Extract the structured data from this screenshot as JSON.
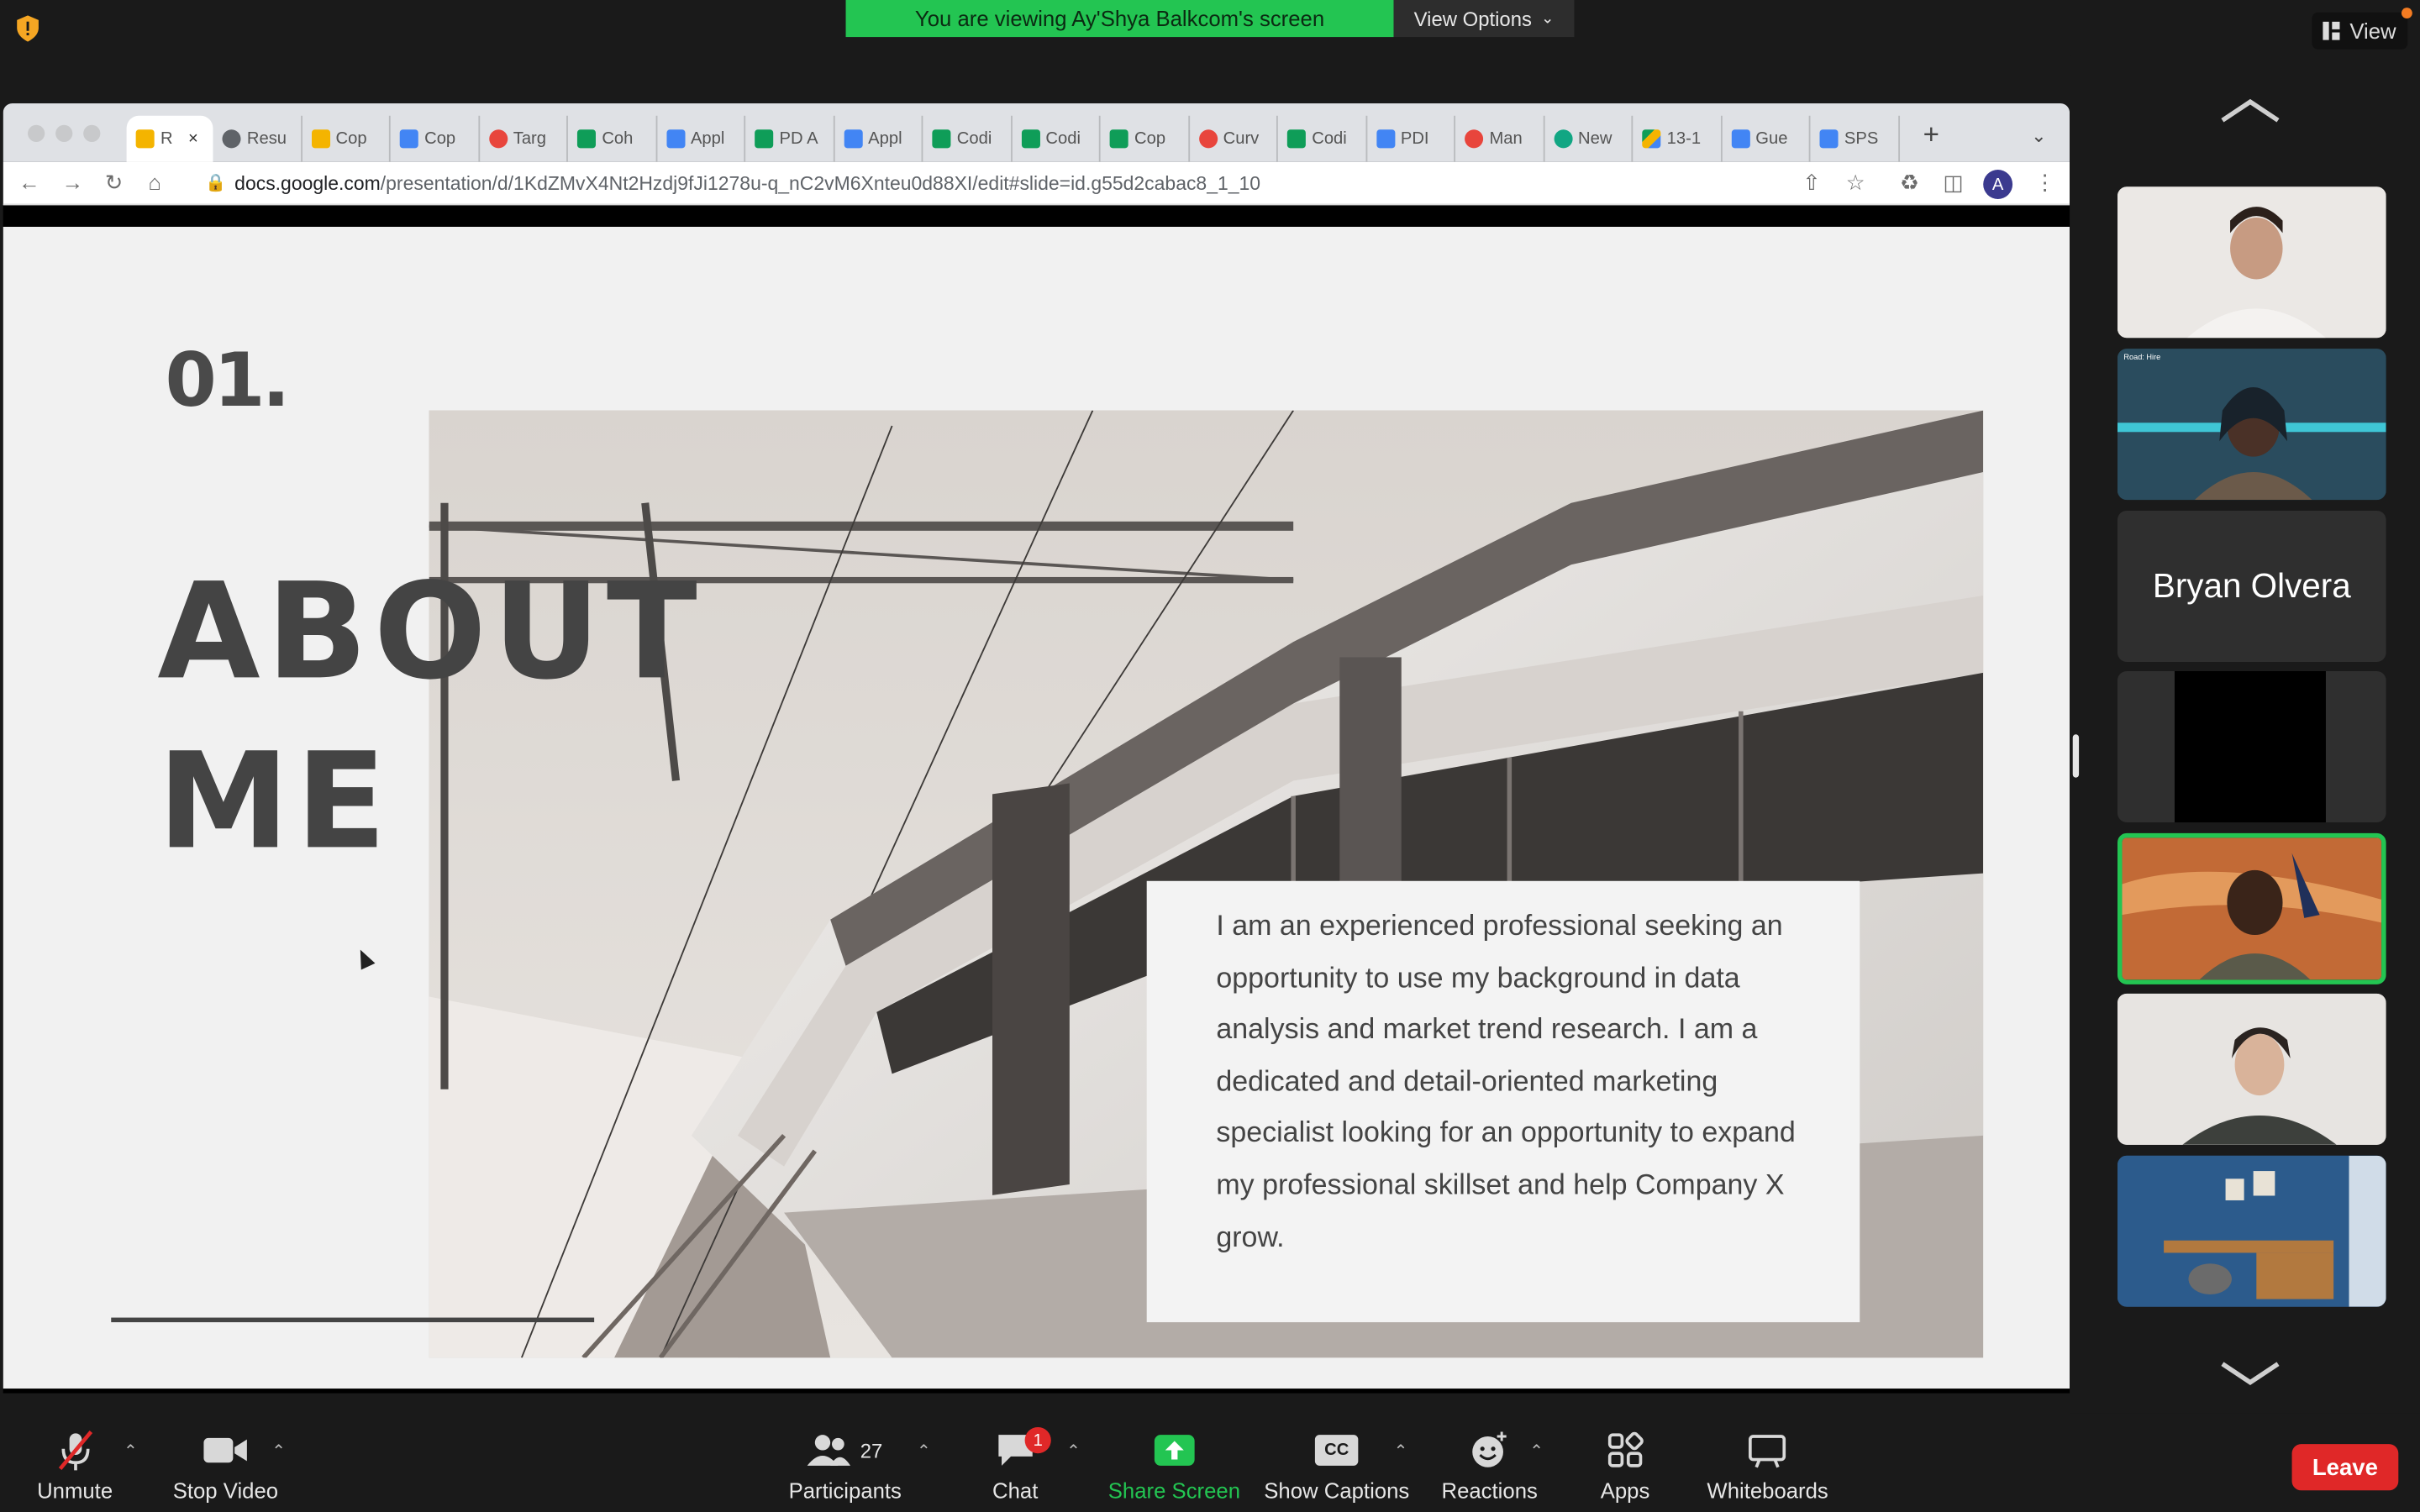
{
  "meeting": {
    "banner_text": "You are viewing Ay'Shya Balkcom's screen",
    "view_options_label": "View Options",
    "view_label": "View"
  },
  "browser": {
    "tabs": [
      {
        "label": "R",
        "icon": "slides",
        "active": true
      },
      {
        "label": "Resu",
        "icon": "globe"
      },
      {
        "label": "Cop",
        "icon": "slides"
      },
      {
        "label": "Cop",
        "icon": "docs"
      },
      {
        "label": "Targ",
        "icon": "red"
      },
      {
        "label": "Coh",
        "icon": "sheets"
      },
      {
        "label": "Appl",
        "icon": "docs"
      },
      {
        "label": "PD A",
        "icon": "sheets"
      },
      {
        "label": "Appl",
        "icon": "docs"
      },
      {
        "label": "Codi",
        "icon": "sheets"
      },
      {
        "label": "Codi",
        "icon": "sheets"
      },
      {
        "label": "Cop",
        "icon": "sheets"
      },
      {
        "label": "Curv",
        "icon": "red"
      },
      {
        "label": "Codi",
        "icon": "sheets"
      },
      {
        "label": "PDI",
        "icon": "docs"
      },
      {
        "label": "Man",
        "icon": "red"
      },
      {
        "label": "New",
        "icon": "teal"
      },
      {
        "label": "13-1",
        "icon": "drive"
      },
      {
        "label": "Gue",
        "icon": "docs"
      },
      {
        "label": "SPS",
        "icon": "docs"
      }
    ],
    "new_tab": "+",
    "url_host": "docs.google.com",
    "url_path": "/presentation/d/1KdZMvX4Nt2Hzdj9fJi1278u-q_nC2vM6Xnteu0d88XI/edit#slide=id.g55d2cabac8_1_10",
    "profile_initial": "A"
  },
  "slide": {
    "number": "01.",
    "title_line1": "ABOUT",
    "title_line2": "ME",
    "bio": "I am an experienced professional seeking an opportunity to use my background in data analysis and market trend research. I am a dedicated and detail-oriented marketing specialist looking for an opportunity to expand my professional skillset and help Company X grow."
  },
  "gallery": {
    "name_tile": "Bryan Olvera",
    "mini_banner": "Road: Hire"
  },
  "toolbar": {
    "unmute": "Unmute",
    "stop_video": "Stop Video",
    "participants": "Participants",
    "participants_count": "27",
    "chat": "Chat",
    "chat_badge": "1",
    "share_screen": "Share Screen",
    "show_captions": "Show Captions",
    "captions_icon_text": "CC",
    "reactions": "Reactions",
    "apps": "Apps",
    "whiteboards": "Whiteboards",
    "leave": "Leave"
  }
}
